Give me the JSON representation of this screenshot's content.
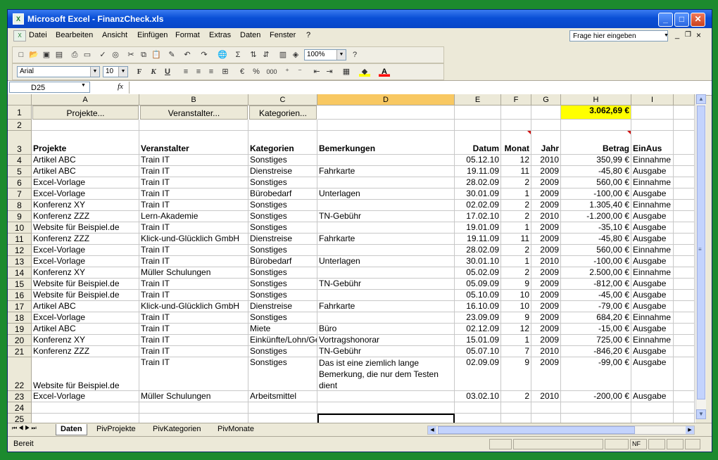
{
  "window": {
    "title": "Microsoft Excel - FinanzCheck.xls",
    "buttons": {
      "minimize": "_",
      "maximize": "□",
      "close": "✕"
    }
  },
  "menu": {
    "items": [
      "Datei",
      "Bearbeiten",
      "Ansicht",
      "Einfügen",
      "Format",
      "Extras",
      "Daten",
      "Fenster",
      "?"
    ],
    "help_placeholder": "Frage hier eingeben"
  },
  "toolbar": {
    "zoom": "100%",
    "font": "Arial",
    "font_size": "10",
    "bold": "F",
    "italic": "K",
    "underline": "U",
    "percent": "%",
    "thousands": "000"
  },
  "formula_bar": {
    "cell_ref": "D25",
    "fx": "fx",
    "content": ""
  },
  "columns": [
    {
      "id": "A",
      "label": "A"
    },
    {
      "id": "B",
      "label": "B"
    },
    {
      "id": "C",
      "label": "C"
    },
    {
      "id": "D",
      "label": "D"
    },
    {
      "id": "E",
      "label": "E"
    },
    {
      "id": "F",
      "label": "F"
    },
    {
      "id": "G",
      "label": "G"
    },
    {
      "id": "H",
      "label": "H"
    },
    {
      "id": "I",
      "label": "I"
    }
  ],
  "buttons_row": {
    "projekte": "Projekte...",
    "veranstalter": "Veranstalter...",
    "kategorien": "Kategorien...",
    "total": "3.062,69 €"
  },
  "headers": [
    "Projekte",
    "Veranstalter",
    "Kategorien",
    "Bemerkungen",
    "Datum",
    "Monat",
    "Jahr",
    "Betrag",
    "EinAus"
  ],
  "rows": [
    {
      "n": "4",
      "a": "Artikel ABC",
      "b": "Train IT",
      "c": "Sonstiges",
      "d": "",
      "e": "05.12.10",
      "f": "12",
      "g": "2010",
      "h": "350,99 €",
      "i": "Einnahme"
    },
    {
      "n": "5",
      "a": "Artikel ABC",
      "b": "Train IT",
      "c": "Dienstreise",
      "d": "Fahrkarte",
      "e": "19.11.09",
      "f": "11",
      "g": "2009",
      "h": "-45,80 €",
      "i": "Ausgabe"
    },
    {
      "n": "6",
      "a": "Excel-Vorlage",
      "b": "Train IT",
      "c": "Sonstiges",
      "d": "",
      "e": "28.02.09",
      "f": "2",
      "g": "2009",
      "h": "560,00 €",
      "i": "Einnahme"
    },
    {
      "n": "7",
      "a": "Excel-Vorlage",
      "b": "Train IT",
      "c": "Bürobedarf",
      "d": "Unterlagen",
      "e": "30.01.09",
      "f": "1",
      "g": "2009",
      "h": "-100,00 €",
      "i": "Ausgabe"
    },
    {
      "n": "8",
      "a": "Konferenz XY",
      "b": "Train IT",
      "c": "Sonstiges",
      "d": "",
      "e": "02.02.09",
      "f": "2",
      "g": "2009",
      "h": "1.305,40 €",
      "i": "Einnahme"
    },
    {
      "n": "9",
      "a": "Konferenz ZZZ",
      "b": "Lern-Akademie",
      "c": "Sonstiges",
      "d": "TN-Gebühr",
      "e": "17.02.10",
      "f": "2",
      "g": "2010",
      "h": "-1.200,00 €",
      "i": "Ausgabe"
    },
    {
      "n": "10",
      "a": "Website für Beispiel.de",
      "b": "Train IT",
      "c": "Sonstiges",
      "d": "",
      "e": "19.01.09",
      "f": "1",
      "g": "2009",
      "h": "-35,10 €",
      "i": "Ausgabe"
    },
    {
      "n": "11",
      "a": "Konferenz ZZZ",
      "b": "Klick-und-Glücklich GmbH",
      "c": "Dienstreise",
      "d": "Fahrkarte",
      "e": "19.11.09",
      "f": "11",
      "g": "2009",
      "h": "-45,80 €",
      "i": "Ausgabe"
    },
    {
      "n": "12",
      "a": "Excel-Vorlage",
      "b": "Train IT",
      "c": "Sonstiges",
      "d": "",
      "e": "28.02.09",
      "f": "2",
      "g": "2009",
      "h": "560,00 €",
      "i": "Einnahme"
    },
    {
      "n": "13",
      "a": "Excel-Vorlage",
      "b": "Train IT",
      "c": "Bürobedarf",
      "d": "Unterlagen",
      "e": "30.01.10",
      "f": "1",
      "g": "2010",
      "h": "-100,00 €",
      "i": "Ausgabe"
    },
    {
      "n": "14",
      "a": "Konferenz XY",
      "b": "Müller Schulungen",
      "c": "Sonstiges",
      "d": "",
      "e": "05.02.09",
      "f": "2",
      "g": "2009",
      "h": "2.500,00 €",
      "i": "Einnahme"
    },
    {
      "n": "15",
      "a": "Website für Beispiel.de",
      "b": "Train IT",
      "c": "Sonstiges",
      "d": "TN-Gebühr",
      "e": "05.09.09",
      "f": "9",
      "g": "2009",
      "h": "-812,00 €",
      "i": "Ausgabe"
    },
    {
      "n": "16",
      "a": "Website für Beispiel.de",
      "b": "Train IT",
      "c": "Sonstiges",
      "d": "",
      "e": "05.10.09",
      "f": "10",
      "g": "2009",
      "h": "-45,00 €",
      "i": "Ausgabe"
    },
    {
      "n": "17",
      "a": "Artikel ABC",
      "b": "Klick-und-Glücklich GmbH",
      "c": "Dienstreise",
      "d": "Fahrkarte",
      "e": "16.10.09",
      "f": "10",
      "g": "2009",
      "h": "-79,00 €",
      "i": "Ausgabe"
    },
    {
      "n": "18",
      "a": "Excel-Vorlage",
      "b": "Train IT",
      "c": "Sonstiges",
      "d": "",
      "e": "23.09.09",
      "f": "9",
      "g": "2009",
      "h": "684,20 €",
      "i": "Einnahme"
    },
    {
      "n": "19",
      "a": "Artikel ABC",
      "b": "Train IT",
      "c": "Miete",
      "d": "Büro",
      "e": "02.12.09",
      "f": "12",
      "g": "2009",
      "h": "-15,00 €",
      "i": "Ausgabe"
    },
    {
      "n": "20",
      "a": "Konferenz XY",
      "b": "Train IT",
      "c": "Einkünfte/Lohn/Gehalt",
      "d": "Vortragshonorar",
      "e": "15.01.09",
      "f": "1",
      "g": "2009",
      "h": "725,00 €",
      "i": "Einnahme"
    },
    {
      "n": "21",
      "a": "Konferenz ZZZ",
      "b": "Train IT",
      "c": "Sonstiges",
      "d": "TN-Gebühr",
      "e": "05.07.10",
      "f": "7",
      "g": "2010",
      "h": "-846,20 €",
      "i": "Ausgabe"
    },
    {
      "n": "22",
      "a": "Website für Beispiel.de",
      "b": "Train IT",
      "c": "Sonstiges",
      "d": "Das ist eine ziemlich lange Bemerkung, die nur dem Testen dient",
      "e": "02.09.09",
      "f": "9",
      "g": "2009",
      "h": "-99,00 €",
      "i": "Ausgabe"
    },
    {
      "n": "23",
      "a": "Excel-Vorlage",
      "b": "Müller Schulungen",
      "c": "Arbeitsmittel",
      "d": "",
      "e": "03.02.10",
      "f": "2",
      "g": "2010",
      "h": "-200,00 €",
      "i": "Ausgabe"
    }
  ],
  "row_labels": {
    "r1": "1",
    "r2": "2",
    "r3": "3",
    "r24": "24",
    "r25": "25"
  },
  "sheet_tabs": [
    "Daten",
    "PivProjekte",
    "PivKategorien",
    "PivMonate"
  ],
  "status": {
    "text": "Bereit",
    "nf": "NF"
  },
  "colors": {
    "highlight": "#ffff00",
    "selected_col": "#f8c862",
    "titlebar": "#0a4fd6"
  }
}
